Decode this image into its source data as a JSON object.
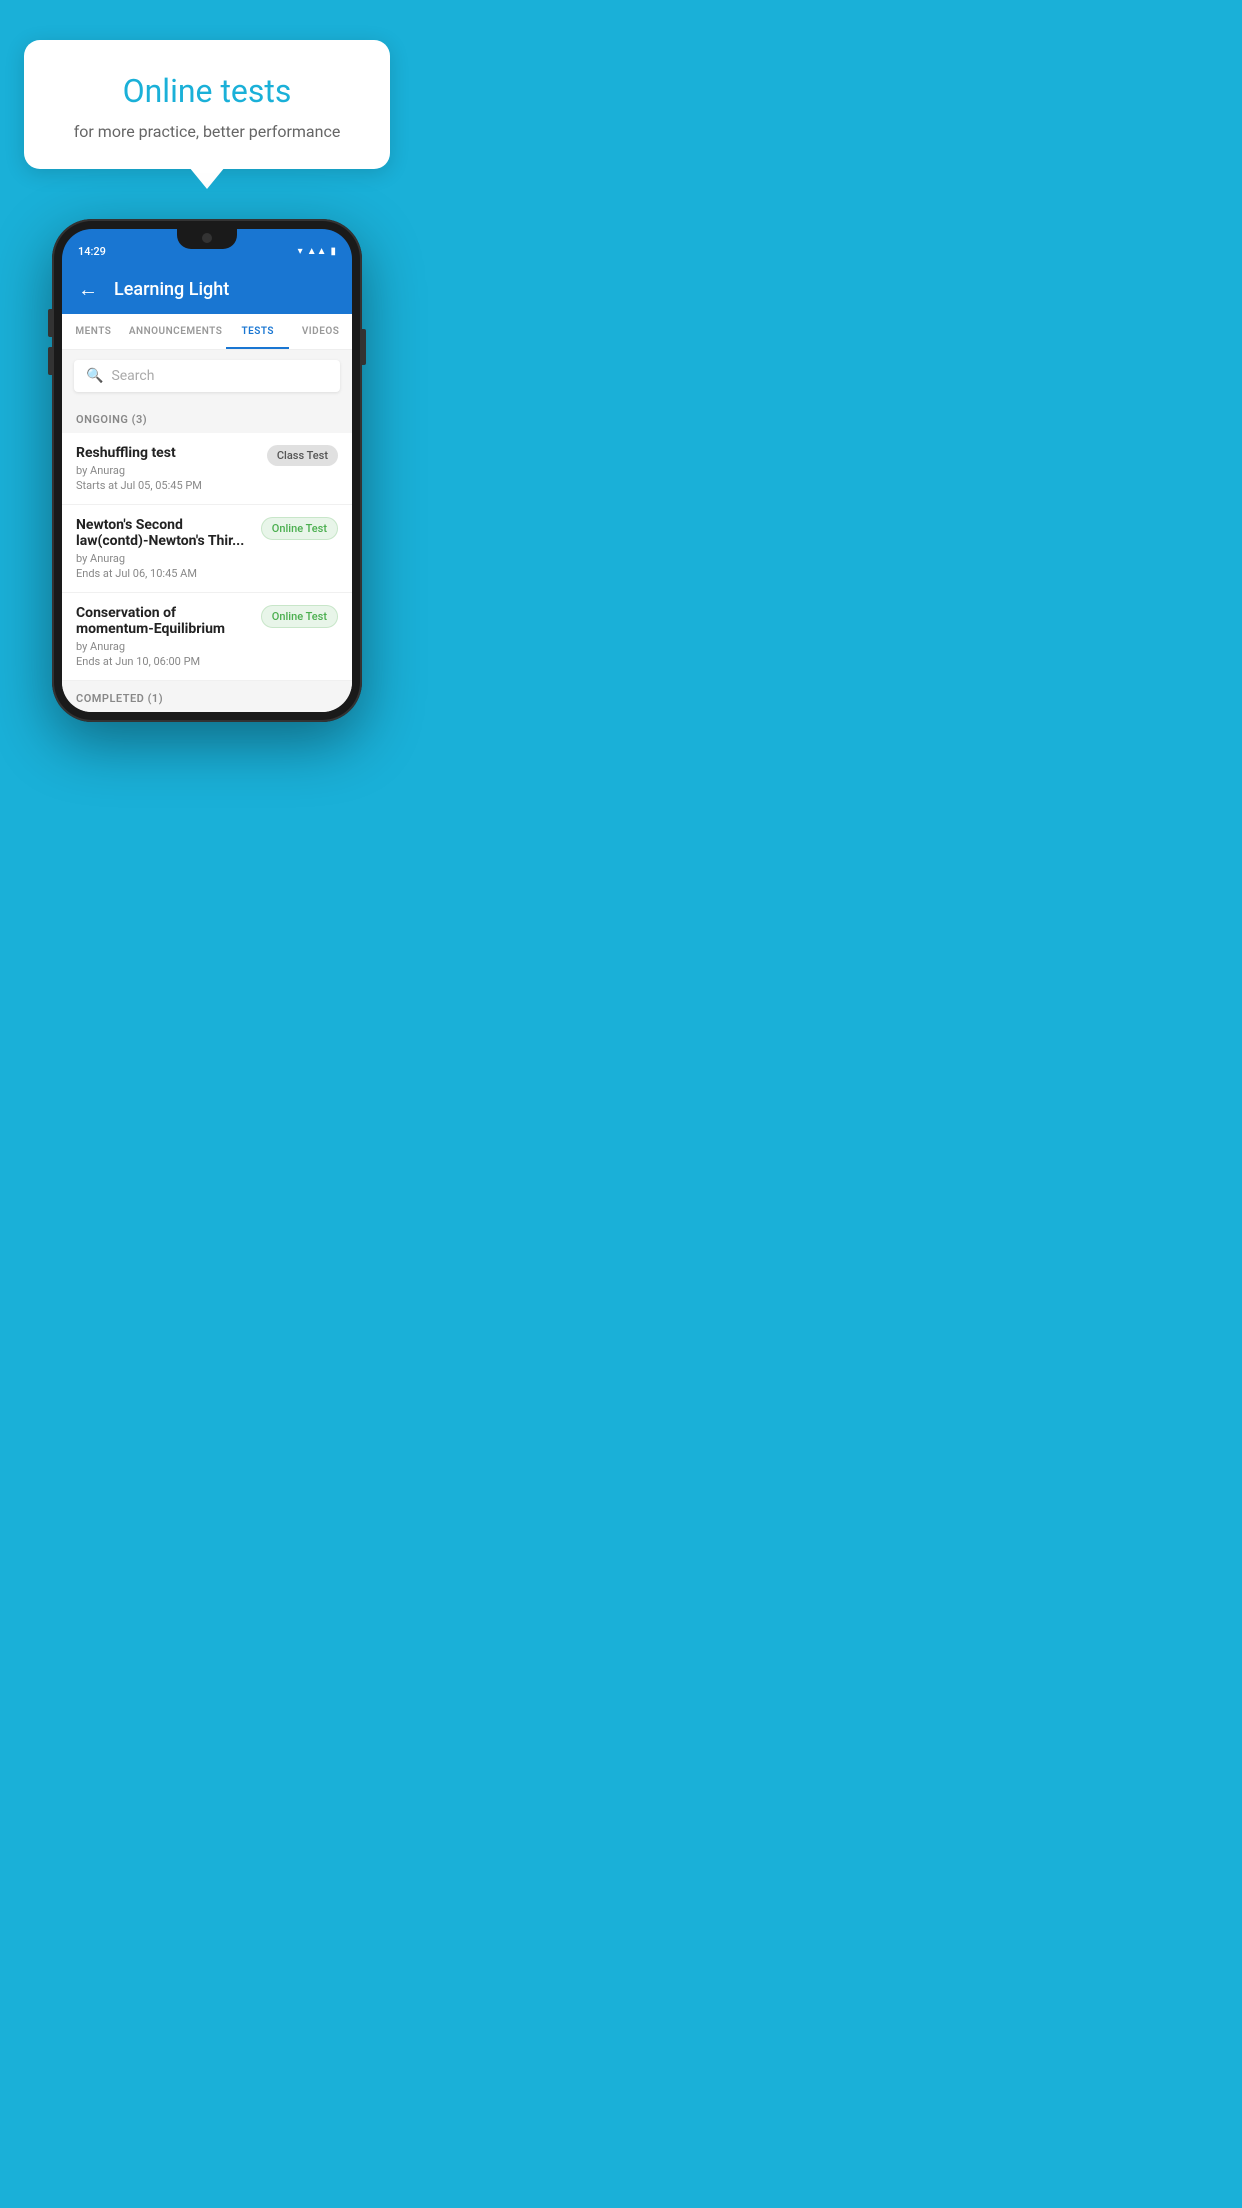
{
  "background_color": "#1ab0d8",
  "bubble": {
    "title": "Online tests",
    "subtitle": "for more practice, better performance"
  },
  "phone": {
    "status_bar": {
      "time": "14:29",
      "wifi_icon": "wifi-icon",
      "signal_icon": "signal-icon",
      "battery_icon": "battery-icon"
    },
    "toolbar": {
      "back_label": "←",
      "title": "Learning Light"
    },
    "tabs": [
      {
        "label": "MENTS",
        "active": false
      },
      {
        "label": "ANNOUNCEMENTS",
        "active": false
      },
      {
        "label": "TESTS",
        "active": true
      },
      {
        "label": "VIDEOS",
        "active": false
      }
    ],
    "search": {
      "placeholder": "Search"
    },
    "ongoing_section": {
      "label": "ONGOING (3)"
    },
    "tests": [
      {
        "name": "Reshuffling test",
        "author": "by Anurag",
        "time_label": "Starts at",
        "time_value": "Jul 05, 05:45 PM",
        "badge": "Class Test",
        "badge_type": "class"
      },
      {
        "name": "Newton's Second law(contd)-Newton's Thir...",
        "author": "by Anurag",
        "time_label": "Ends at",
        "time_value": "Jul 06, 10:45 AM",
        "badge": "Online Test",
        "badge_type": "online"
      },
      {
        "name": "Conservation of momentum-Equilibrium",
        "author": "by Anurag",
        "time_label": "Ends at",
        "time_value": "Jun 10, 06:00 PM",
        "badge": "Online Test",
        "badge_type": "online"
      }
    ],
    "completed_section": {
      "label": "COMPLETED (1)"
    }
  }
}
